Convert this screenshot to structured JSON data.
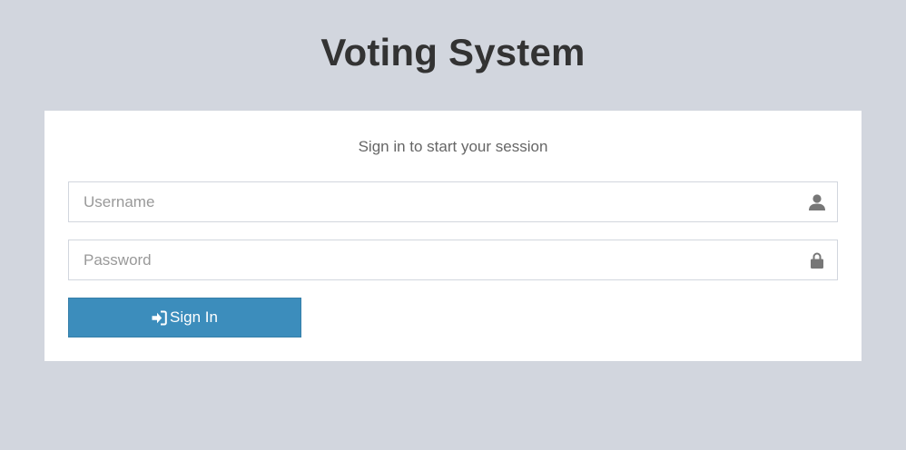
{
  "app": {
    "title": "Voting System"
  },
  "login": {
    "message": "Sign in to start your session",
    "username": {
      "value": "",
      "placeholder": "Username",
      "icon": "user-icon"
    },
    "password": {
      "value": "",
      "placeholder": "Password",
      "icon": "lock-icon"
    },
    "submit": {
      "label": "Sign In",
      "icon": "sign-in-icon"
    }
  },
  "colors": {
    "background": "#d2d6de",
    "box": "#ffffff",
    "primary": "#3c8dbc",
    "primary_border": "#367fa9",
    "title_text": "#333333",
    "icon": "#777777"
  }
}
